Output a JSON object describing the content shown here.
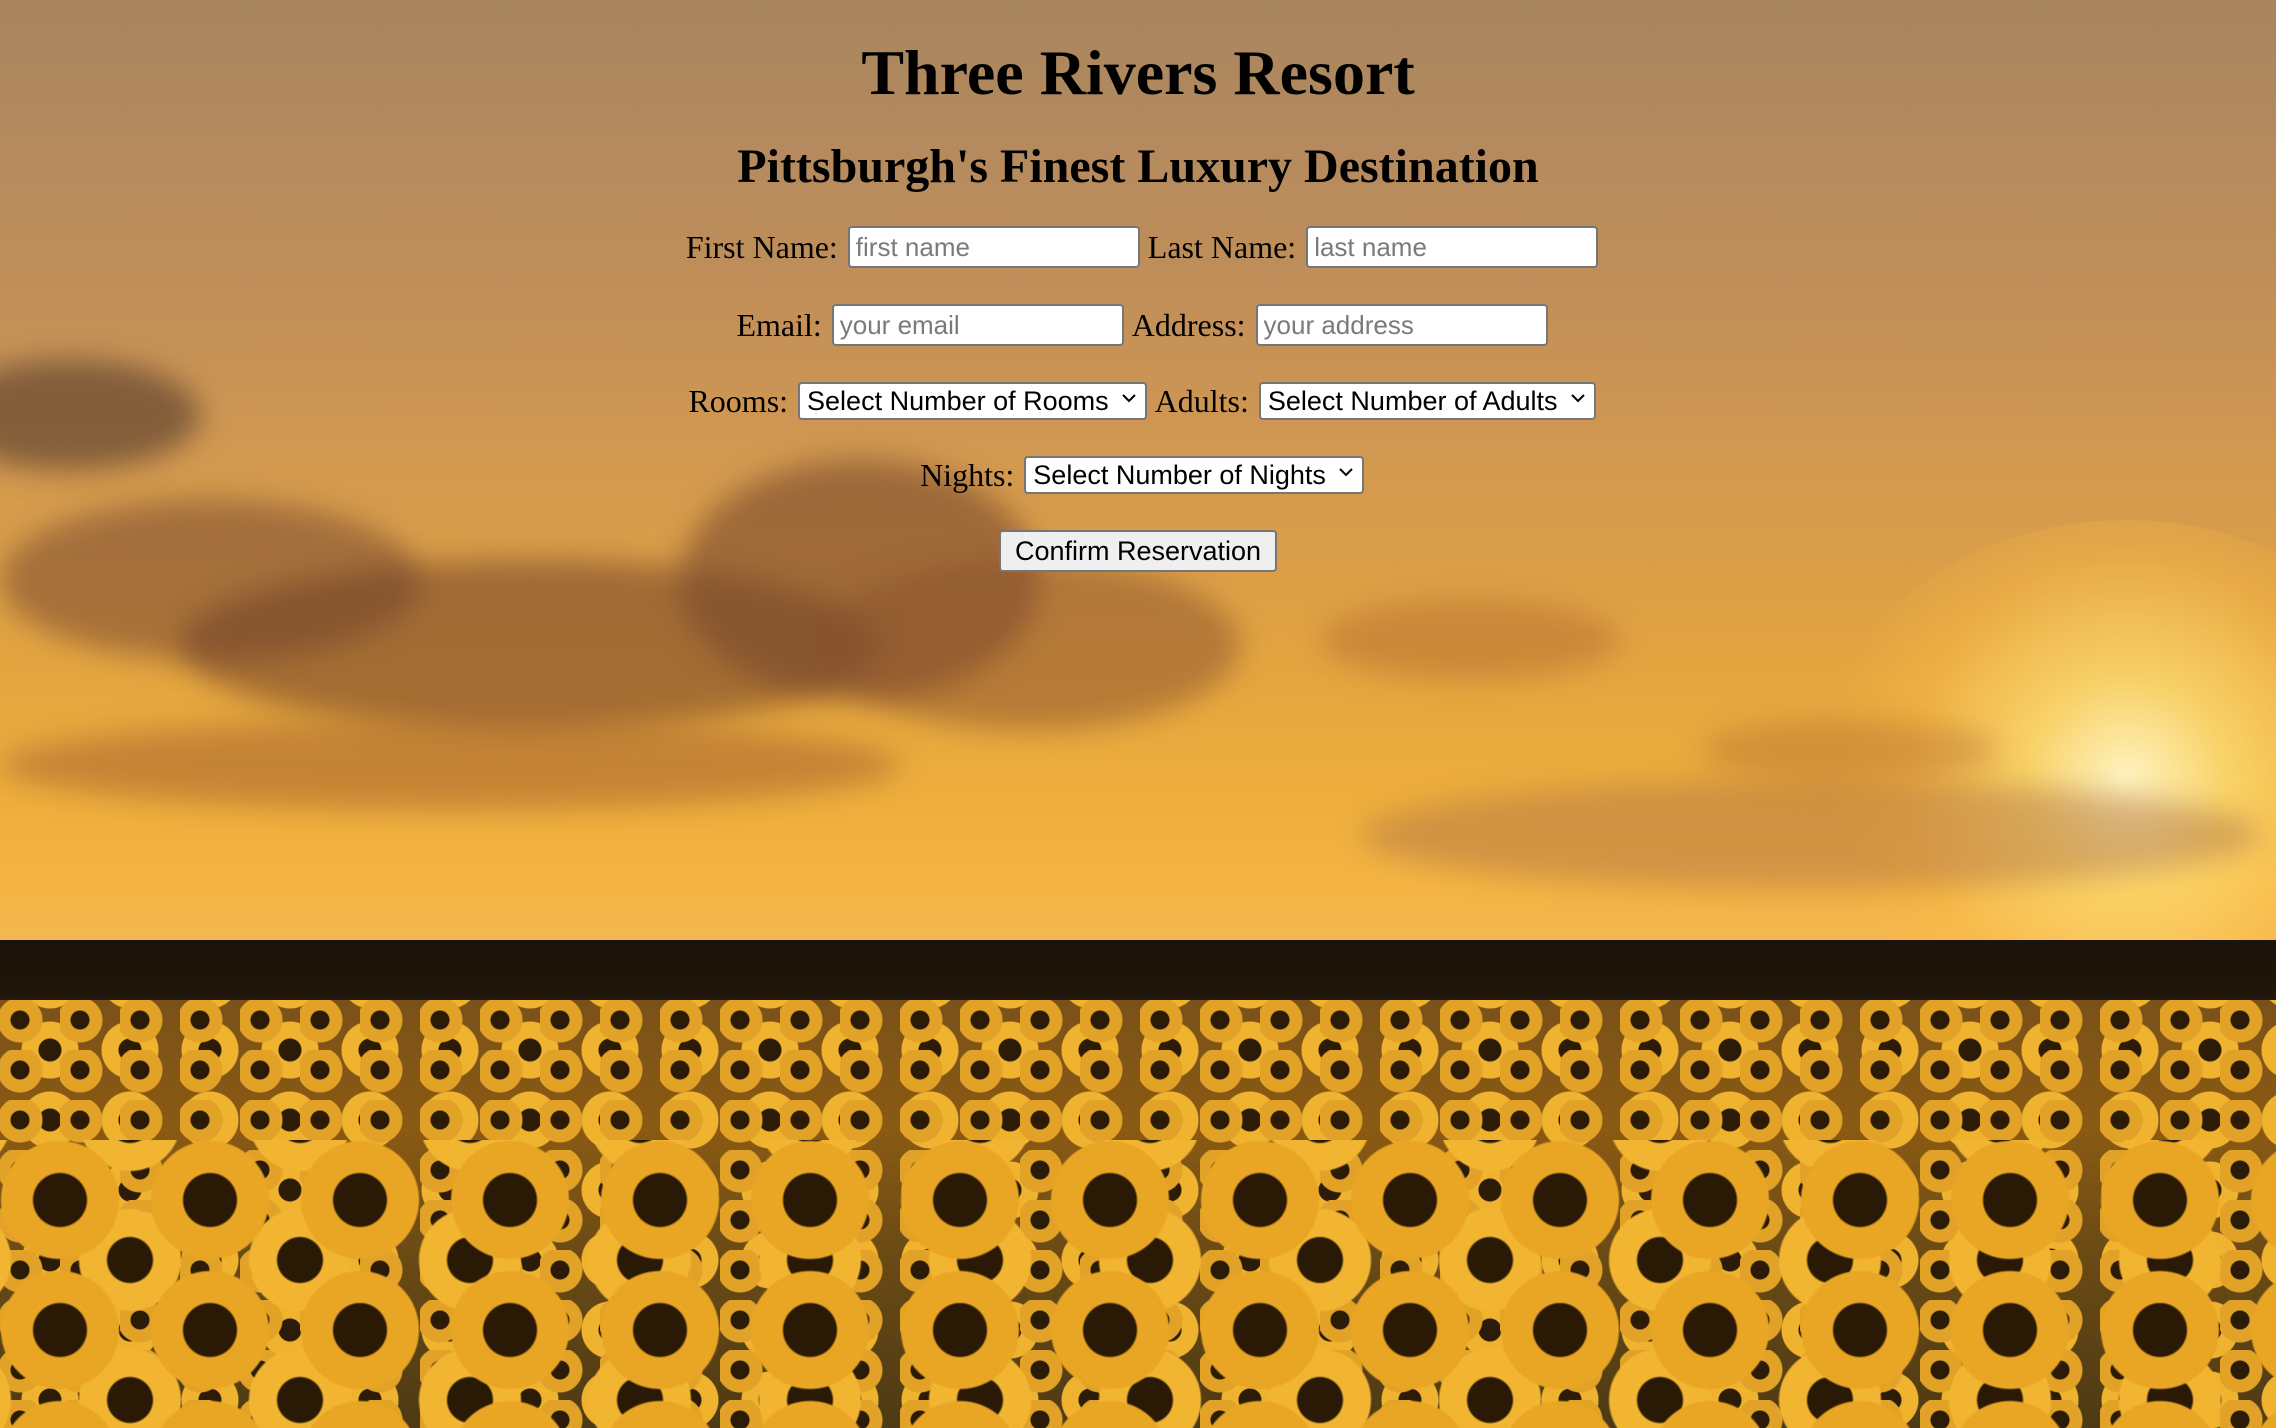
{
  "header": {
    "title": "Three Rivers Resort",
    "subtitle": "Pittsburgh's Finest Luxury Destination"
  },
  "form": {
    "first_name": {
      "label": "First Name:",
      "placeholder": "first name",
      "value": ""
    },
    "last_name": {
      "label": "Last Name:",
      "placeholder": "last name",
      "value": ""
    },
    "email": {
      "label": "Email:",
      "placeholder": "your email",
      "value": ""
    },
    "address": {
      "label": "Address:",
      "placeholder": "your address",
      "value": ""
    },
    "rooms": {
      "label": "Rooms:",
      "selected": "Select Number of Rooms"
    },
    "adults": {
      "label": "Adults:",
      "selected": "Select Number of Adults"
    },
    "nights": {
      "label": "Nights:",
      "selected": "Select Number of Nights"
    },
    "submit_label": "Confirm Reservation"
  },
  "icons": {
    "dropdown": "chevron-down-icon"
  },
  "background": {
    "description_colors": {
      "sky_top": "#a8855f",
      "sky_bottom": "#f5b543",
      "sunflower": "#f0b330"
    }
  }
}
